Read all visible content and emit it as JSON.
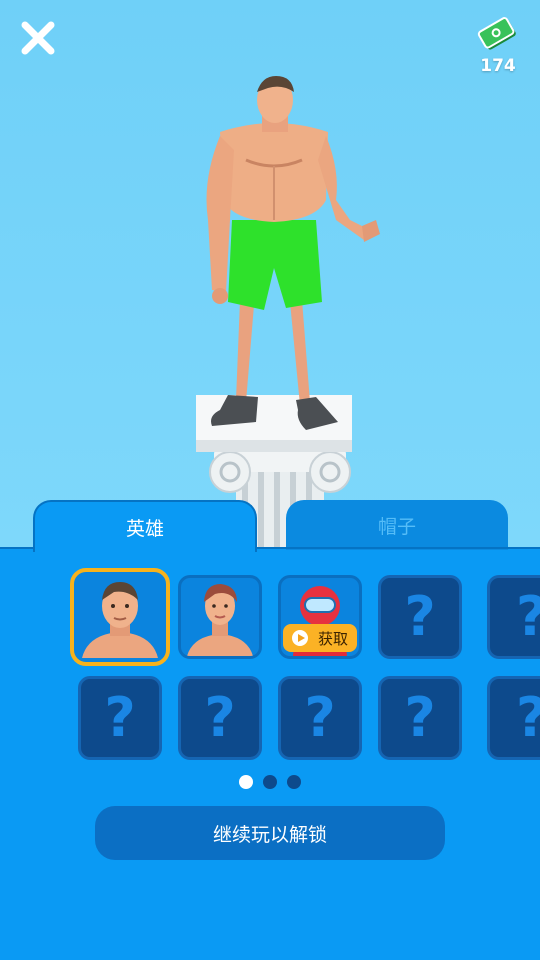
{
  "header": {
    "cash_icon": "cash-icon",
    "cash_count": "174",
    "close_icon": "close-icon"
  },
  "tabs": [
    {
      "label": "英雄",
      "active": true
    },
    {
      "label": "帽子",
      "active": false
    }
  ],
  "grid": {
    "row1": [
      {
        "type": "character",
        "name": "hero-1",
        "selected": true
      },
      {
        "type": "character",
        "name": "hero-2"
      },
      {
        "type": "character",
        "name": "red-suit",
        "badge": "获取"
      },
      {
        "type": "locked",
        "label": "?"
      },
      {
        "type": "locked",
        "label": "?"
      }
    ],
    "row2": [
      {
        "type": "locked",
        "label": "?"
      },
      {
        "type": "locked",
        "label": "?"
      },
      {
        "type": "locked",
        "label": "?"
      },
      {
        "type": "locked",
        "label": "?"
      },
      {
        "type": "locked",
        "label": "?"
      }
    ]
  },
  "pagination": {
    "pages": 3,
    "current": 1
  },
  "cta": {
    "label": "继续玩以解锁"
  },
  "colors": {
    "sky": "#74d2f8",
    "panel": "#0a9af4",
    "accent": "#f7b21c",
    "locked": "#0d4a8c"
  }
}
